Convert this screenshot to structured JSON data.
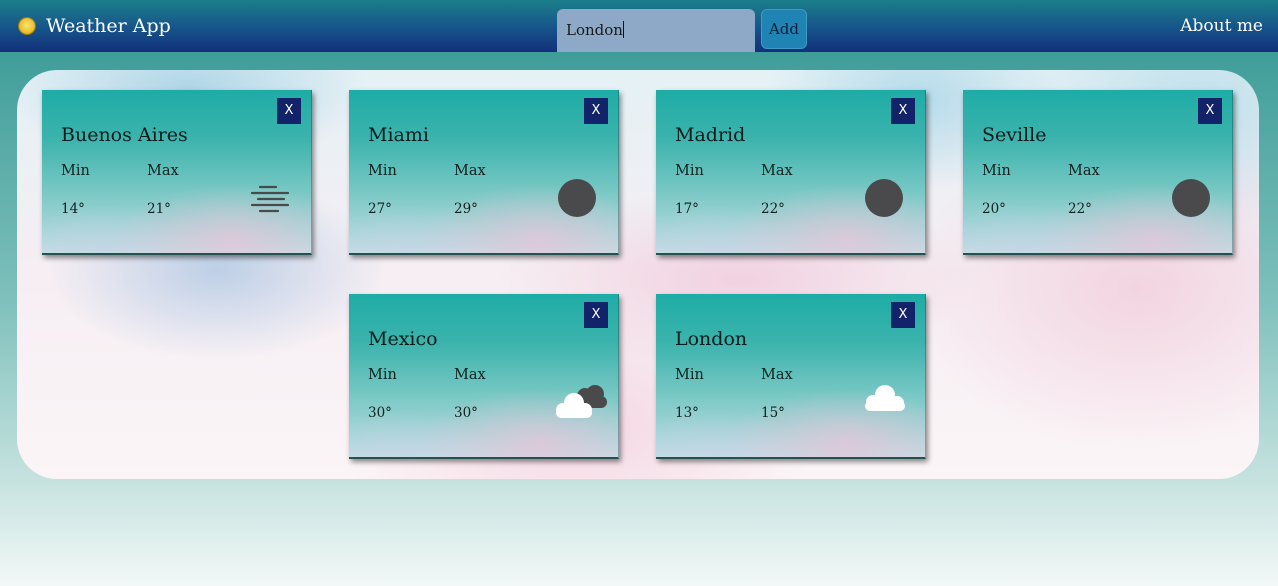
{
  "app": {
    "title": "Weather App",
    "logo_icon": "sun-icon"
  },
  "search": {
    "value": "London",
    "add_label": "Add"
  },
  "nav": {
    "about_label": "About me"
  },
  "cards": [
    {
      "city": "Buenos Aires",
      "min_label": "Min",
      "max_label": "Max",
      "min": "14°",
      "max": "21°",
      "icon": "mist-icon",
      "close_label": "X"
    },
    {
      "city": "Miami",
      "min_label": "Min",
      "max_label": "Max",
      "min": "27°",
      "max": "29°",
      "icon": "clear-night-icon",
      "close_label": "X"
    },
    {
      "city": "Madrid",
      "min_label": "Min",
      "max_label": "Max",
      "min": "17°",
      "max": "22°",
      "icon": "clear-night-icon",
      "close_label": "X"
    },
    {
      "city": "Seville",
      "min_label": "Min",
      "max_label": "Max",
      "min": "20°",
      "max": "22°",
      "icon": "clear-night-icon",
      "close_label": "X"
    },
    {
      "city": "Mexico",
      "min_label": "Min",
      "max_label": "Max",
      "min": "30°",
      "max": "30°",
      "icon": "broken-clouds-icon",
      "close_label": "X"
    },
    {
      "city": "London",
      "min_label": "Min",
      "max_label": "Max",
      "min": "13°",
      "max": "15°",
      "icon": "cloud-icon",
      "close_label": "X"
    }
  ],
  "colors": {
    "navbar_top": "#1b7f8a",
    "navbar_bottom": "#12307a",
    "card_top": "#1eaca6",
    "close_button": "#12236a",
    "add_button": "#1f84b4",
    "search_bg": "#8ea9c8",
    "moon": "#4a4a4c"
  }
}
